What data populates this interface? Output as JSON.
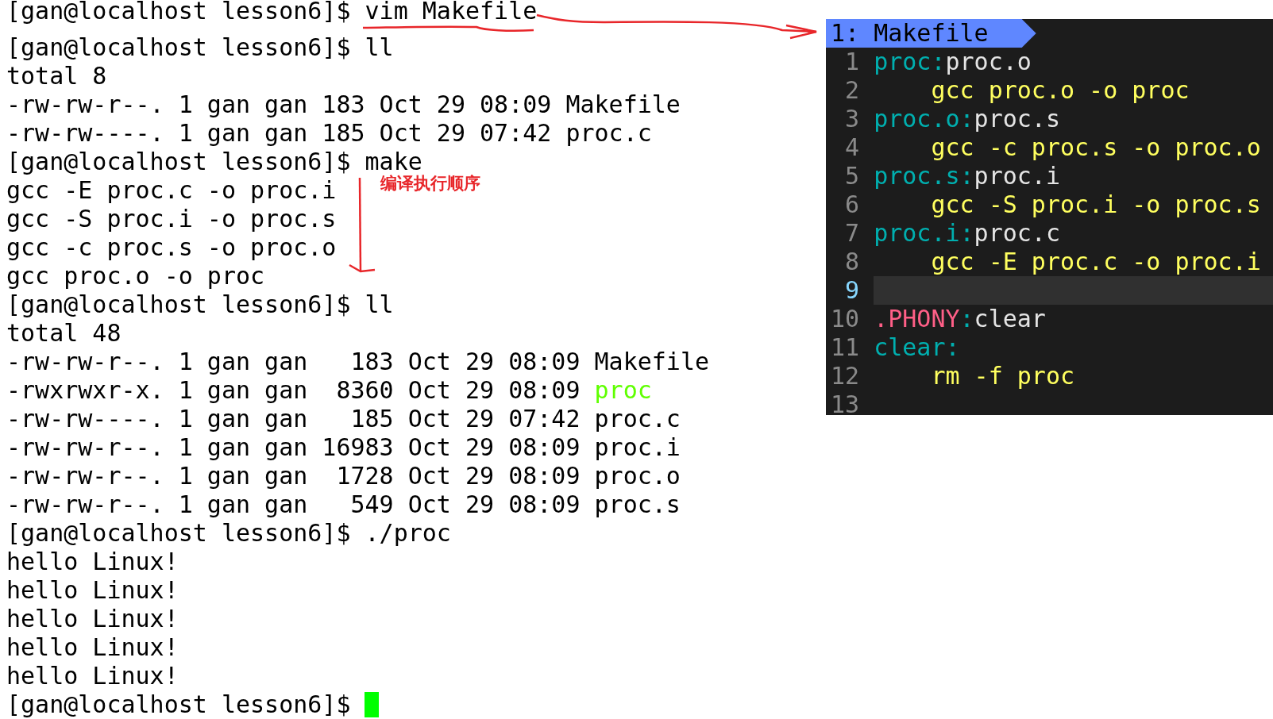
{
  "terminal": {
    "cursor_visible": true,
    "lines": [
      {
        "segments": [
          {
            "text": "[gan@localhost lesson6]$ vim Makefile"
          }
        ]
      },
      {
        "segments": [
          {
            "text": "[gan@localhost lesson6]$ ll"
          }
        ]
      },
      {
        "segments": [
          {
            "text": "total 8"
          }
        ]
      },
      {
        "segments": [
          {
            "text": "-rw-rw-r--. 1 gan gan 183 Oct 29 08:09 Makefile"
          }
        ]
      },
      {
        "segments": [
          {
            "text": "-rw-rw----. 1 gan gan 185 Oct 29 07:42 proc.c"
          }
        ]
      },
      {
        "segments": [
          {
            "text": "[gan@localhost lesson6]$ make"
          }
        ]
      },
      {
        "segments": [
          {
            "text": "gcc -E proc.c -o proc.i"
          }
        ]
      },
      {
        "segments": [
          {
            "text": "gcc -S proc.i -o proc.s"
          }
        ]
      },
      {
        "segments": [
          {
            "text": "gcc -c proc.s -o proc.o"
          }
        ]
      },
      {
        "segments": [
          {
            "text": "gcc proc.o -o proc"
          }
        ]
      },
      {
        "segments": [
          {
            "text": "[gan@localhost lesson6]$ ll"
          }
        ]
      },
      {
        "segments": [
          {
            "text": "total 48"
          }
        ]
      },
      {
        "segments": [
          {
            "text": "-rw-rw-r--. 1 gan gan   183 Oct 29 08:09 Makefile"
          }
        ]
      },
      {
        "segments": [
          {
            "text": "-rwxrwxr-x. 1 gan gan  8360 Oct 29 08:09 "
          },
          {
            "text": "proc",
            "kind": "executable"
          }
        ]
      },
      {
        "segments": [
          {
            "text": "-rw-rw----. 1 gan gan   185 Oct 29 07:42 proc.c"
          }
        ]
      },
      {
        "segments": [
          {
            "text": "-rw-rw-r--. 1 gan gan 16983 Oct 29 08:09 proc.i"
          }
        ]
      },
      {
        "segments": [
          {
            "text": "-rw-rw-r--. 1 gan gan  1728 Oct 29 08:09 proc.o"
          }
        ]
      },
      {
        "segments": [
          {
            "text": "-rw-rw-r--. 1 gan gan   549 Oct 29 08:09 proc.s"
          }
        ]
      },
      {
        "segments": [
          {
            "text": "[gan@localhost lesson6]$ ./proc"
          }
        ]
      },
      {
        "segments": [
          {
            "text": "hello Linux!"
          }
        ]
      },
      {
        "segments": [
          {
            "text": "hello Linux!"
          }
        ]
      },
      {
        "segments": [
          {
            "text": "hello Linux!"
          }
        ]
      },
      {
        "segments": [
          {
            "text": "hello Linux!"
          }
        ]
      },
      {
        "segments": [
          {
            "text": "hello Linux!"
          }
        ]
      },
      {
        "segments": [
          {
            "text": "[gan@localhost lesson6]$"
          }
        ]
      }
    ]
  },
  "vim": {
    "buffer_tab": {
      "label": "1: Makefile"
    },
    "lines": [
      {
        "number": "1",
        "current": false,
        "kind": "rule",
        "segments": [
          {
            "text": "proc:",
            "kind": "target"
          },
          {
            "text": "proc.o",
            "kind": "plain"
          }
        ]
      },
      {
        "number": "2",
        "current": false,
        "kind": "recipe",
        "segments": [
          {
            "text": "gcc proc.o -o proc",
            "kind": "command"
          }
        ]
      },
      {
        "number": "3",
        "current": false,
        "kind": "rule",
        "segments": [
          {
            "text": "proc.o:",
            "kind": "target"
          },
          {
            "text": "proc.s",
            "kind": "plain"
          }
        ]
      },
      {
        "number": "4",
        "current": false,
        "kind": "recipe",
        "segments": [
          {
            "text": "gcc -c proc.s -o proc.o",
            "kind": "command"
          }
        ]
      },
      {
        "number": "5",
        "current": false,
        "kind": "rule",
        "segments": [
          {
            "text": "proc.s:",
            "kind": "target"
          },
          {
            "text": "proc.i",
            "kind": "plain"
          }
        ]
      },
      {
        "number": "6",
        "current": false,
        "kind": "recipe",
        "segments": [
          {
            "text": "gcc -S proc.i -o proc.s",
            "kind": "command"
          }
        ]
      },
      {
        "number": "7",
        "current": false,
        "kind": "rule",
        "segments": [
          {
            "text": "proc.i:",
            "kind": "target"
          },
          {
            "text": "proc.c",
            "kind": "plain"
          }
        ]
      },
      {
        "number": "8",
        "current": false,
        "kind": "recipe",
        "segments": [
          {
            "text": "gcc -E proc.c -o proc.i",
            "kind": "command"
          }
        ]
      },
      {
        "number": "9",
        "current": true
      },
      {
        "number": "10",
        "current": false,
        "kind": "rule",
        "segments": [
          {
            "text": ".PHONY",
            "kind": "special"
          },
          {
            "text": ":",
            "kind": "target"
          },
          {
            "text": "clear",
            "kind": "plain"
          }
        ]
      },
      {
        "number": "11",
        "current": false,
        "kind": "rule",
        "segments": [
          {
            "text": "clear:",
            "kind": "target"
          }
        ]
      },
      {
        "number": "12",
        "current": false,
        "kind": "recipe",
        "segments": [
          {
            "text": "rm -f proc",
            "kind": "command"
          }
        ]
      },
      {
        "number": "13",
        "current": false
      }
    ]
  },
  "annotations": [
    {
      "kind": "note",
      "text": "编译执行顺序"
    }
  ]
}
